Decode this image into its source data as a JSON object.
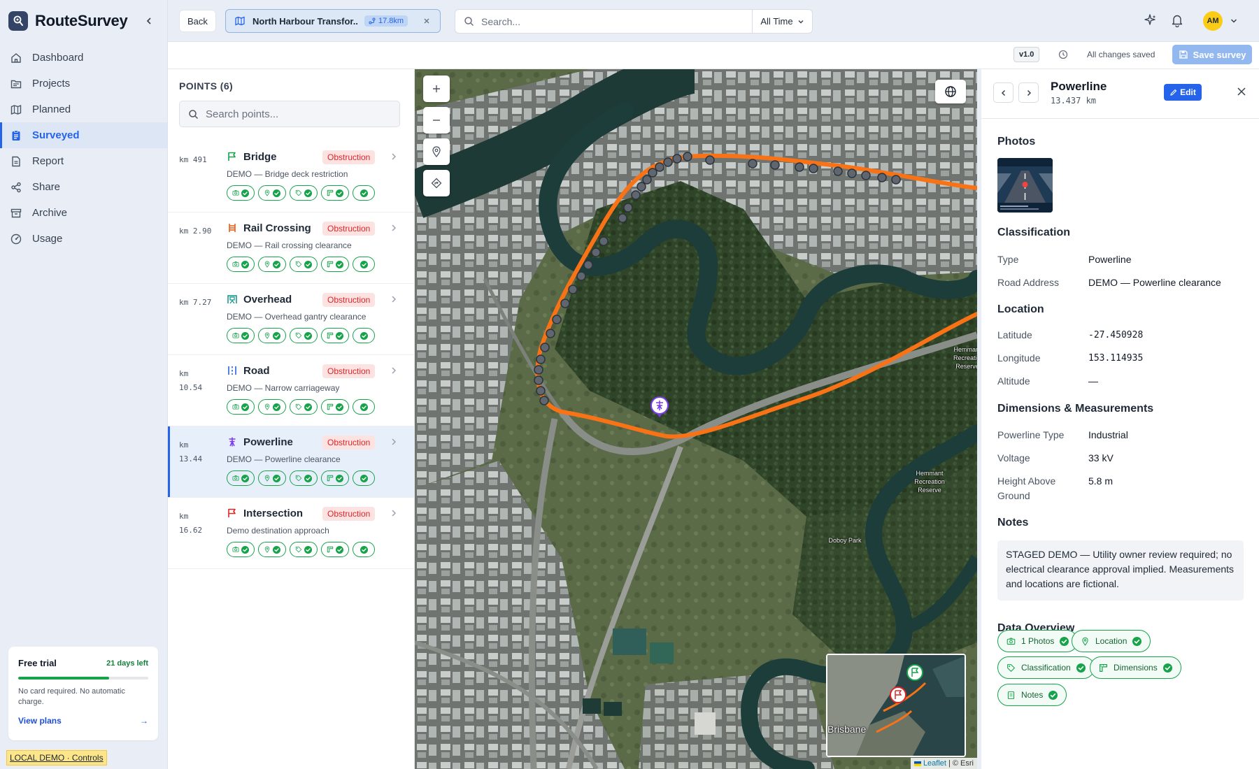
{
  "app": {
    "name": "RouteSurvey"
  },
  "nav": [
    {
      "label": "Dashboard",
      "icon": "home-icon"
    },
    {
      "label": "Projects",
      "icon": "folder-icon"
    },
    {
      "label": "Planned",
      "icon": "map-icon"
    },
    {
      "label": "Surveyed",
      "icon": "clipboard-icon",
      "active": true
    },
    {
      "label": "Report",
      "icon": "document-icon"
    },
    {
      "label": "Share",
      "icon": "share-icon"
    },
    {
      "label": "Archive",
      "icon": "archive-icon"
    },
    {
      "label": "Usage",
      "icon": "gauge-icon"
    }
  ],
  "trial": {
    "title": "Free trial",
    "days_left": "21 days left",
    "progress": 0.7,
    "note": "No card required. No automatic charge.",
    "link": "View plans",
    "link_arrow": "→"
  },
  "demo_link": "LOCAL DEMO · Controls",
  "header": {
    "back": "Back",
    "project_name": "North Harbour Transfor...",
    "project_distance": "17.8km",
    "search_placeholder": "Search...",
    "time_filter": "All Time",
    "avatar_initials": "AM"
  },
  "toolbar": {
    "version": "v1.0",
    "status": "All changes saved",
    "save": "Save survey"
  },
  "points": {
    "title": "POINTS (6)",
    "search_placeholder": "Search points...",
    "items": [
      {
        "km": "km 491",
        "name": "Bridge",
        "badge": "Obstruction",
        "desc": "DEMO — Bridge deck restriction",
        "icon": "flag-icon",
        "color": "#16a34a"
      },
      {
        "km": "km 2.90",
        "name": "Rail Crossing",
        "badge": "Obstruction",
        "desc": "DEMO — Rail crossing clearance",
        "icon": "rail-icon",
        "color": "#ea580c"
      },
      {
        "km": "km 7.27",
        "name": "Overhead",
        "badge": "Obstruction",
        "desc": "DEMO — Overhead gantry clearance",
        "icon": "gantry-icon",
        "color": "#0d9488"
      },
      {
        "km": "km 10.54",
        "name": "Road",
        "badge": "Obstruction",
        "desc": "DEMO — Narrow carriageway",
        "icon": "road-icon",
        "color": "#2563eb"
      },
      {
        "km": "km 13.44",
        "name": "Powerline",
        "badge": "Obstruction",
        "desc": "DEMO — Powerline clearance",
        "icon": "powerline-icon",
        "color": "#7c3aed",
        "selected": true
      },
      {
        "km": "km 16.62",
        "name": "Intersection",
        "badge": "Obstruction",
        "desc": "Demo destination approach",
        "icon": "finish-flag-icon",
        "color": "#dc2626"
      }
    ]
  },
  "map": {
    "attribution_leaflet": "Leaflet",
    "attribution_rest": "| © Esri",
    "labels": {
      "hemmant_top": "Hemmant Recreation Reserve",
      "hemmant_mid": "Hemmant Recreation Reserve",
      "doboy": "Doboy Park",
      "brisbane": "Brisbane"
    },
    "route_color": "#f97316"
  },
  "detail": {
    "title": "Powerline",
    "subtitle": "13.437 km",
    "edit": "Edit",
    "sections": {
      "photos": "Photos",
      "classification": "Classification",
      "location": "Location",
      "dimensions": "Dimensions & Measurements",
      "notes": "Notes",
      "overview": "Data Overview"
    },
    "classification": [
      {
        "label": "Type",
        "value": "Powerline"
      },
      {
        "label": "Road Address",
        "value": "DEMO — Powerline clearance"
      }
    ],
    "location": [
      {
        "label": "Latitude",
        "value": "-27.450928"
      },
      {
        "label": "Longitude",
        "value": "153.114935"
      },
      {
        "label": "Altitude",
        "value": "—"
      }
    ],
    "dimensions": [
      {
        "label": "Powerline Type",
        "value": "Industrial"
      },
      {
        "label": "Voltage",
        "value": "33 kV"
      },
      {
        "label": "Height Above Ground",
        "value": "5.8 m"
      }
    ],
    "notes": "STAGED DEMO — Utility owner review required; no electrical clearance approval implied. Measurements and locations are fictional.",
    "overview": [
      {
        "label": "1 Photos",
        "icon": "camera-icon"
      },
      {
        "label": "Location",
        "icon": "pin-icon"
      },
      {
        "label": "Classification",
        "icon": "tag-icon"
      },
      {
        "label": "Dimensions",
        "icon": "ruler-icon"
      },
      {
        "label": "Notes",
        "icon": "note-icon"
      }
    ]
  }
}
